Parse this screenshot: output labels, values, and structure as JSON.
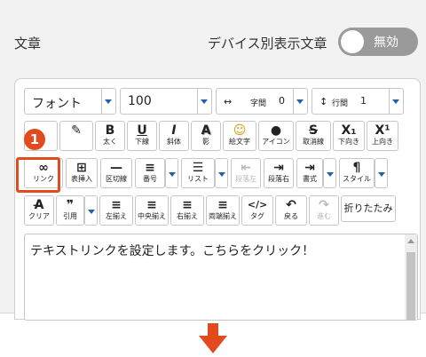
{
  "section_label": "文章",
  "device_toggle": {
    "label": "デバイス別表示文章",
    "state": "無効"
  },
  "toolbar": {
    "font": {
      "label": "フォント"
    },
    "size": {
      "label": "100"
    },
    "letter_spacing": {
      "icon": "↔",
      "label": "字間",
      "value": "0"
    },
    "line_spacing": {
      "icon": "↕",
      "label": "行間",
      "value": "1"
    },
    "row2": [
      {
        "icon": "",
        "label": ""
      },
      {
        "icon": "✎",
        "label": ""
      },
      {
        "icon": "B",
        "label": "太く"
      },
      {
        "icon": "U",
        "label": "下線"
      },
      {
        "icon": "I",
        "label": "斜体"
      },
      {
        "icon": "A",
        "label": "影"
      },
      {
        "icon": "☺",
        "label": "絵文字"
      },
      {
        "icon": "●",
        "label": "アイコン"
      },
      {
        "icon": "S",
        "label": "取消線"
      },
      {
        "icon": "X₁",
        "label": "下向き"
      },
      {
        "icon": "X¹",
        "label": "上向き"
      }
    ],
    "link": {
      "icon": "∞",
      "label": "リンク"
    },
    "table": {
      "icon": "⊞",
      "label": "表挿入"
    },
    "hr": {
      "icon": "—",
      "label": "区切線"
    },
    "number": {
      "icon": "≡",
      "label": "番号"
    },
    "list": {
      "icon": "☰",
      "label": "リスト"
    },
    "outdent": {
      "icon": "⇤",
      "label": "段落左"
    },
    "indent": {
      "icon": "⇥",
      "label": "段落右"
    },
    "format": {
      "icon": "⇥",
      "label": "書式"
    },
    "style": {
      "icon": "¶",
      "label": "スタイル"
    },
    "clear": {
      "icon": "A̶",
      "label": "クリア"
    },
    "quote": {
      "icon": "❞",
      "label": "引用"
    },
    "align_left": {
      "icon": "≡",
      "label": "左揃え"
    },
    "align_center": {
      "icon": "≡",
      "label": "中央揃え"
    },
    "align_right": {
      "icon": "≡",
      "label": "右揃え"
    },
    "align_justify": {
      "icon": "≡",
      "label": "両端揃え"
    },
    "tag": {
      "icon": "</>",
      "label": "タグ"
    },
    "undo": {
      "icon": "↶",
      "label": "戻る"
    },
    "redo": {
      "icon": "↷",
      "label": "進む"
    },
    "fold_label": "折りたたみ"
  },
  "editor_text": "テキストリンクを設定します。こちらをクリック！",
  "callout": {
    "number": "1",
    "color": "#e14b1e"
  },
  "colors": {
    "accent": "#1d63a8",
    "highlight": "#e14b1e",
    "toggle_off": "#9a9a9a"
  }
}
